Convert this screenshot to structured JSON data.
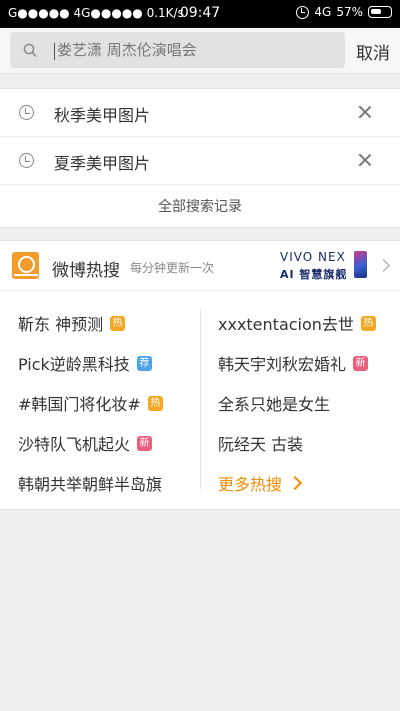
{
  "status_bar": {
    "left": "G●●●●● 4G●●●●● 0.1K/s",
    "time": "09:47",
    "network": "4G",
    "battery": "57%"
  },
  "search": {
    "placeholder": "娄艺潇 周杰伦演唱会",
    "cancel_label": "取消"
  },
  "history": {
    "items": [
      {
        "text": "秋季美甲图片"
      },
      {
        "text": "夏季美甲图片"
      }
    ],
    "all_label": "全部搜索记录"
  },
  "hot": {
    "title": "微博热搜",
    "subtitle": "每分钟更新一次",
    "ad_brand": "VIVO NEX",
    "ad_slogan": "AI 智慧旗舰",
    "left_items": [
      {
        "text": "靳东 神预测",
        "badge": "热",
        "badge_color": "#f5a623"
      },
      {
        "text": "Pick逆龄黑科技",
        "badge": "荐",
        "badge_color": "#4da3e8"
      },
      {
        "text": "#韩国门将化妆#",
        "badge": "热",
        "badge_color": "#f5a623"
      },
      {
        "text": "沙特队飞机起火",
        "badge": "新",
        "badge_color": "#ec5d7e"
      },
      {
        "text": "韩朝共举朝鲜半岛旗",
        "badge": "",
        "badge_color": ""
      }
    ],
    "right_items": [
      {
        "text": "xxxtentacion去世",
        "badge": "热",
        "badge_color": "#f5a623"
      },
      {
        "text": "韩天宇刘秋宏婚礼",
        "badge": "新",
        "badge_color": "#ec5d7e"
      },
      {
        "text": "全系只她是女生",
        "badge": "",
        "badge_color": ""
      },
      {
        "text": "阮经天 古装",
        "badge": "",
        "badge_color": ""
      }
    ],
    "more_label": "更多热搜",
    "accent_color": "#f08c00"
  }
}
